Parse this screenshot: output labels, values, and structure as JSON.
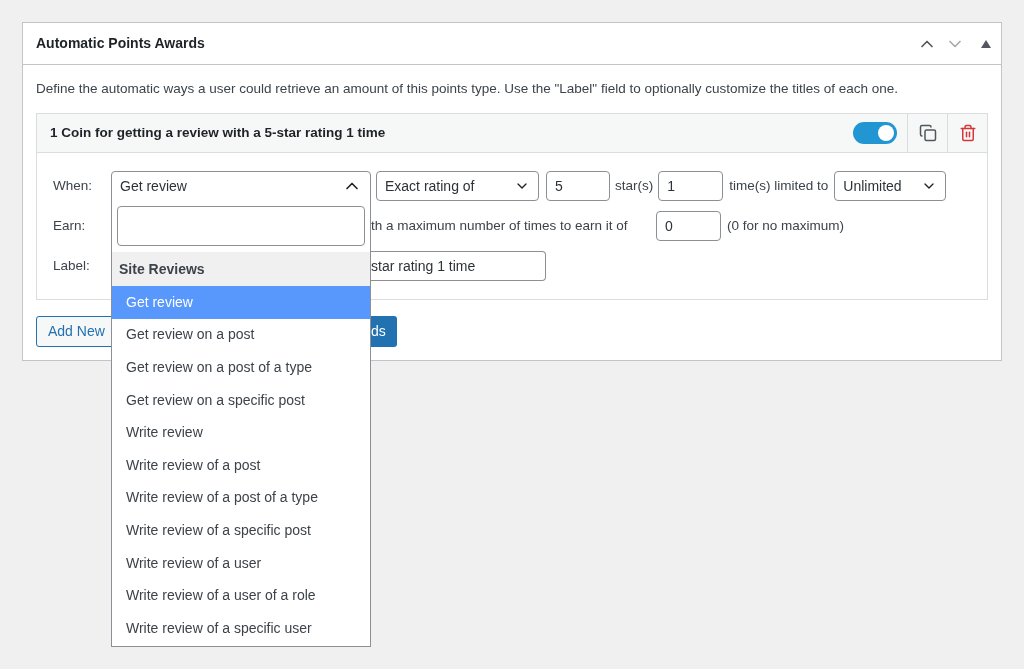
{
  "panel": {
    "title": "Automatic Points Awards",
    "description": "Define the automatic ways a user could retrieve an amount of this points type. Use the \"Label\" field to optionally customize the titles of each one."
  },
  "award": {
    "title": "1 Coin for getting a review with a 5-star rating 1 time",
    "enabled": true,
    "when": {
      "label": "When:",
      "event": "Get review",
      "rating_mode": "Exact rating of",
      "stars": "5",
      "stars_suffix": "star(s)",
      "times": "1",
      "times_suffix": "time(s) limited to",
      "limit": "Unlimited"
    },
    "earn": {
      "label": "Earn:",
      "text": "th a maximum number of times to earn it of",
      "maximum": "0",
      "hint": "(0 for no maximum)"
    },
    "label": {
      "label": "Label:",
      "value": "star rating 1 time"
    }
  },
  "buttons": {
    "add_new": "Add New",
    "save": "ds"
  },
  "dropdown": {
    "group": "Site Reviews",
    "options": [
      {
        "label": "Get review",
        "selected": true
      },
      {
        "label": "Get review on a post",
        "selected": false
      },
      {
        "label": "Get review on a post of a type",
        "selected": false
      },
      {
        "label": "Get review on a specific post",
        "selected": false
      },
      {
        "label": "Write review",
        "selected": false
      },
      {
        "label": "Write review of a post",
        "selected": false
      },
      {
        "label": "Write review of a post of a type",
        "selected": false
      },
      {
        "label": "Write review of a specific post",
        "selected": false
      },
      {
        "label": "Write review of a user",
        "selected": false
      },
      {
        "label": "Write review of a user of a role",
        "selected": false
      },
      {
        "label": "Write review of a specific user",
        "selected": false
      }
    ]
  }
}
